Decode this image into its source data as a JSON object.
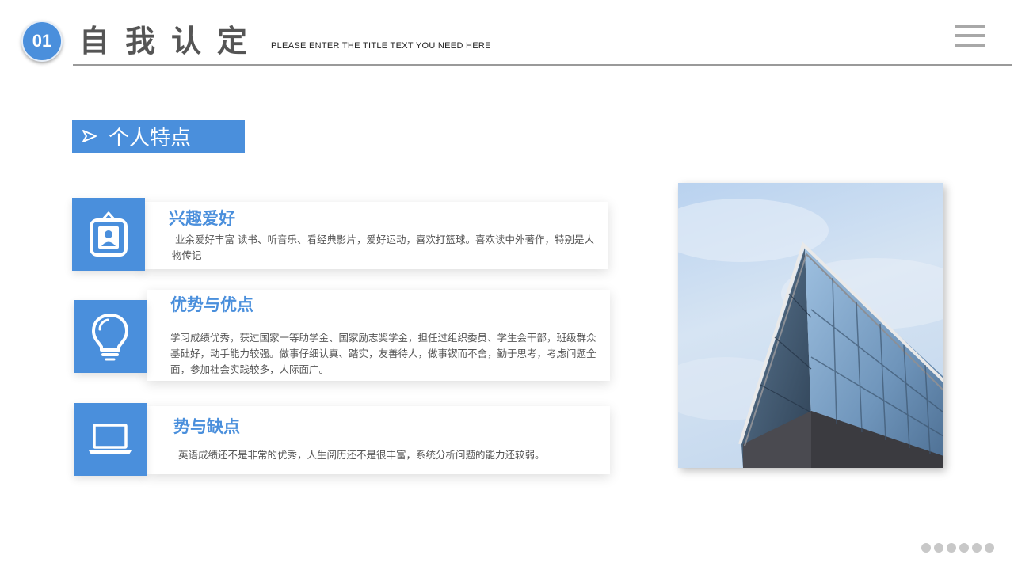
{
  "header": {
    "number": "01",
    "title": "自我认定",
    "subtitle": "PLEASE  ENTER  THE TITLE TEXT  YOU  NEED  HERE"
  },
  "section": {
    "label": "个人特点"
  },
  "cards": [
    {
      "title": "兴趣爱好",
      "description": "业余爱好丰富  读书、听音乐、看经典影片，爱好运动，喜欢打篮球。喜欢读中外著作，特别是人物传记",
      "icon": "id-badge-icon"
    },
    {
      "title": "优势与优点",
      "description": "学习成绩优秀，获过国家一等助学金、国家励志奖学金，担任过组织委员、学生会干部，班级群众基础好，动手能力较强。做事仔细认真、踏实，友善待人，做事锲而不舍，勤于思考，考虑问题全面，参加社会实践较多，人际面广。",
      "icon": "lightbulb-icon"
    },
    {
      "title": "势与缺点",
      "description": "英语成绩还不是非常的优秀，人生阅历还不是很丰富，系统分析问题的能力还较弱。",
      "icon": "laptop-icon"
    }
  ],
  "colors": {
    "accent": "#4a8fdc",
    "title_gray": "#555555",
    "line_gray": "#9a9a9a"
  }
}
